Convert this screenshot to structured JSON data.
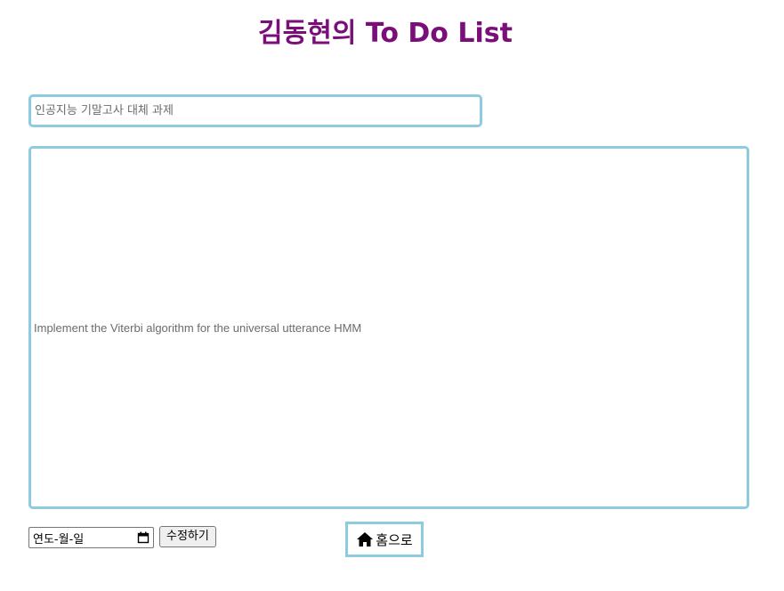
{
  "header": {
    "title": "김동현의 To Do List"
  },
  "form": {
    "title_placeholder": "인공지능 기말고사 대체 과제",
    "title_value": "",
    "content_text": "Implement the Viterbi algorithm for the universal utterance HMM",
    "date_placeholder": "연도-월-일",
    "date_icon": "calendar-icon",
    "edit_label": "수정하기"
  },
  "nav": {
    "home_label": "홈으로",
    "home_icon": "home-icon"
  },
  "colors": {
    "title": "#7a0f7a",
    "accent_border": "#8ccbe0"
  }
}
